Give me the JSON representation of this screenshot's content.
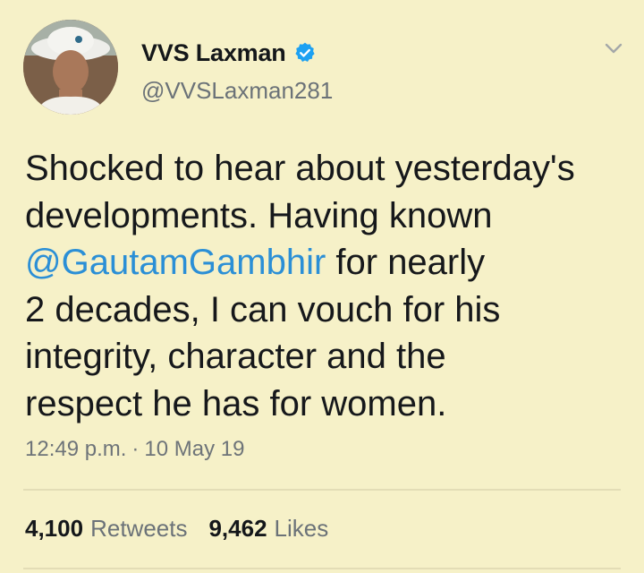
{
  "user": {
    "display_name": "VVS Laxman",
    "handle": "@VVSLaxman281",
    "verified_icon": "verified-badge-icon",
    "avatar_icon": "profile-photo-cricketer-hat"
  },
  "menu": {
    "icon": "chevron-down-icon"
  },
  "tweet": {
    "text_line1": "Shocked to hear about yesterday's",
    "text_line2": "developments. Having known",
    "mention": "@GautamGambhir",
    "text_line3_after": " for nearly",
    "text_line4": "2 decades, I can vouch for his",
    "text_line5": "integrity, character and the",
    "text_line6": "respect he has for women."
  },
  "meta": {
    "time": "12:49 p.m.",
    "separator": "·",
    "date": "10 May 19"
  },
  "stats": {
    "retweets_count": "4,100",
    "retweets_label": "Retweets",
    "likes_count": "9,462",
    "likes_label": "Likes"
  },
  "colors": {
    "background": "#f6f1c8",
    "mention": "#2b8fd6",
    "verified": "#1da1f2",
    "secondary_text": "#6b7278"
  }
}
